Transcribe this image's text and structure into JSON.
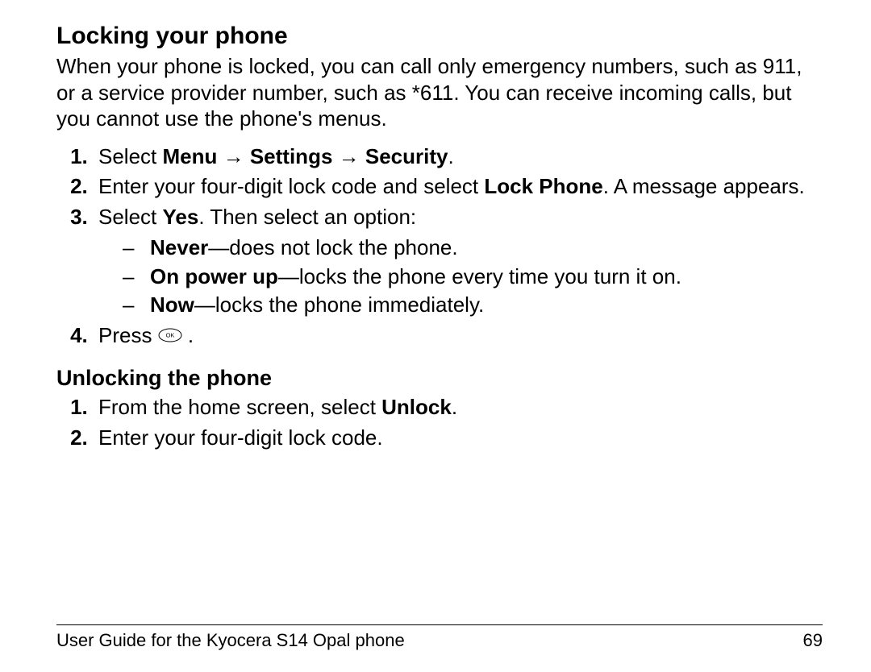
{
  "section1": {
    "title": "Locking your phone",
    "intro": "When your phone is locked, you can call only emergency numbers, such as 911, or a service provider number, such as *611. You can receive incoming calls, but you cannot use the phone's menus.",
    "items": {
      "i1": {
        "pre": "Select ",
        "b1": "Menu",
        "a1": " → ",
        "b2": "Settings",
        "a2": " → ",
        "b3": "Security",
        "post": "."
      },
      "i2": {
        "pre": "Enter your four-digit lock code and select ",
        "b": "Lock Phone",
        "post": ". A message appears."
      },
      "i3": {
        "pre": "Select ",
        "b": "Yes",
        "post": ". Then select an option:"
      },
      "i4": {
        "pre": "Press ",
        "post": " ."
      },
      "sub": {
        "s1": {
          "b": "Never",
          "post": "—does not lock the phone."
        },
        "s2": {
          "b": "On power up",
          "post": "—locks the phone every time you turn it on."
        },
        "s3": {
          "b": "Now",
          "post": "—locks the phone immediately."
        }
      }
    }
  },
  "section2": {
    "title": "Unlocking the phone",
    "items": {
      "i1": {
        "pre": "From the home screen, select ",
        "b": "Unlock",
        "post": "."
      },
      "i2": {
        "text": "Enter your four-digit lock code."
      }
    }
  },
  "footer": {
    "text": "User Guide for the Kyocera S14 Opal phone",
    "page": "69"
  },
  "icons": {
    "ok": "OK"
  }
}
